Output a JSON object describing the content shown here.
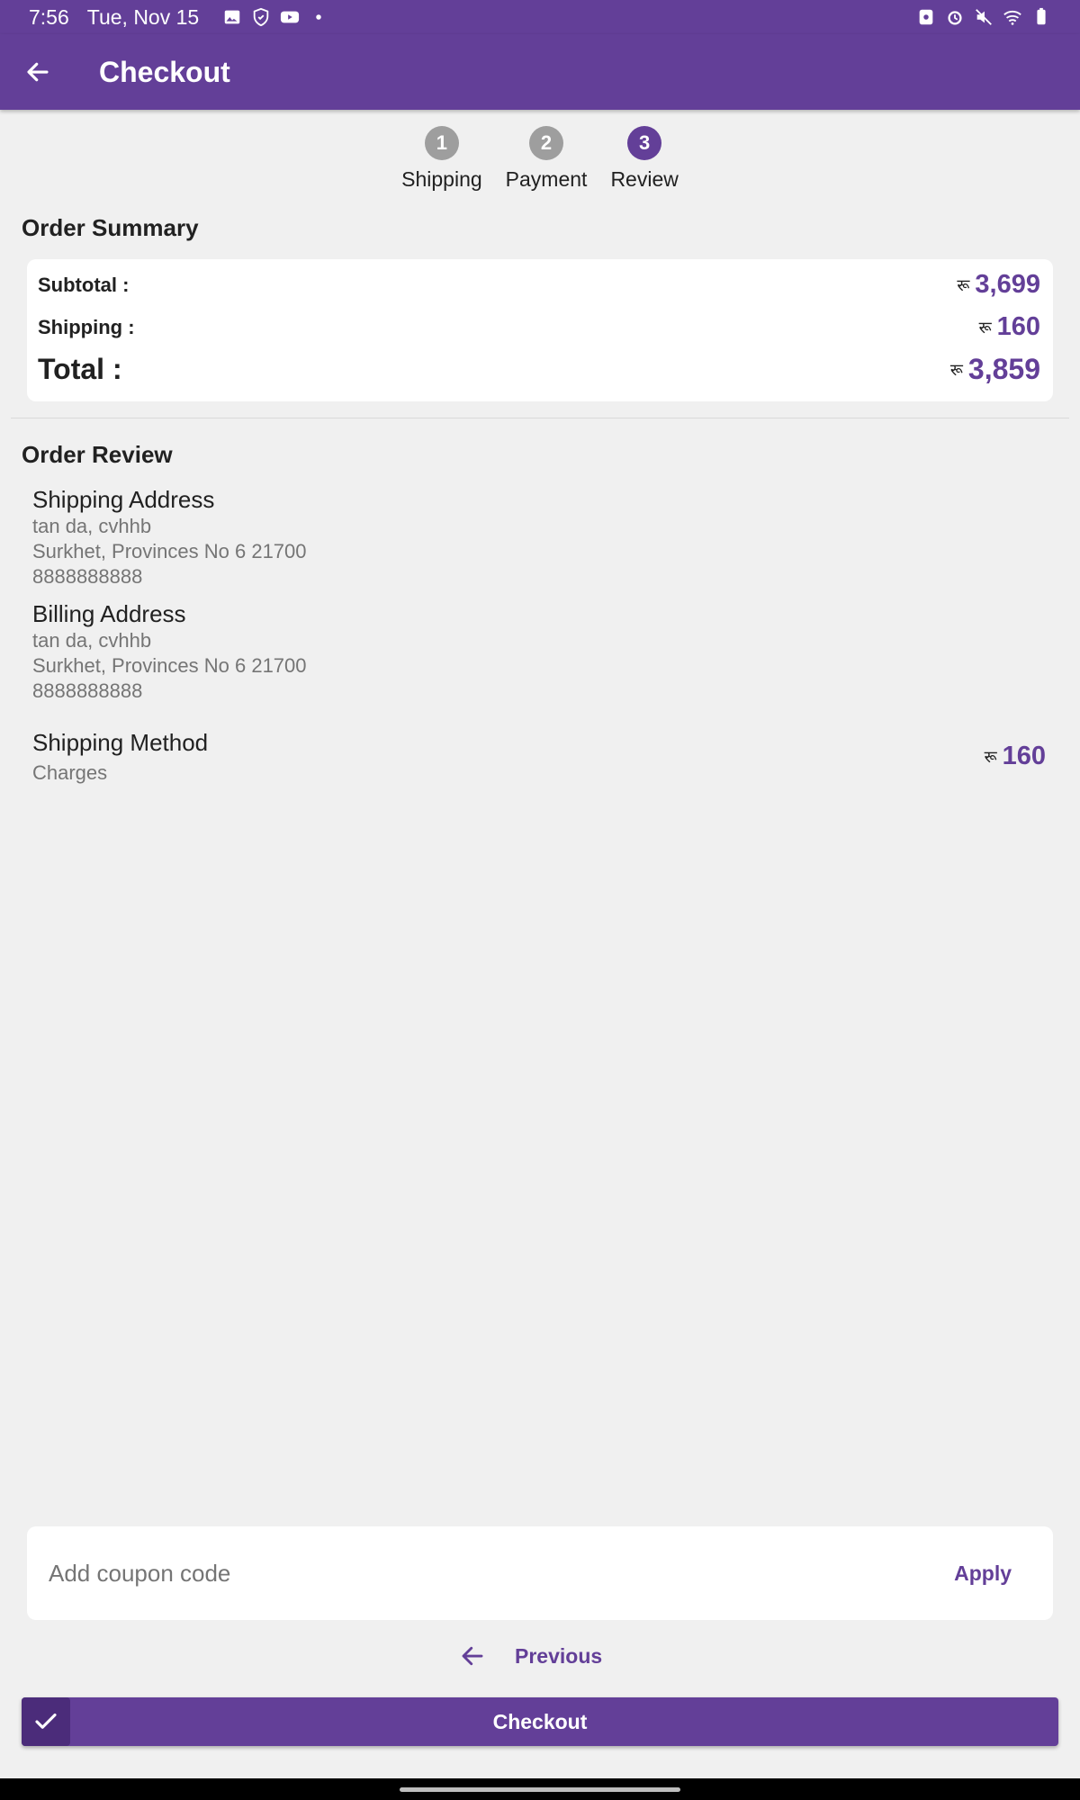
{
  "status_bar": {
    "time": "7:56",
    "date": "Tue, Nov 15",
    "left_icons": [
      "gallery-icon",
      "hand-shield-icon",
      "youtube-icon",
      "dot-icon"
    ],
    "right_icons": [
      "nfc-icon",
      "alarm-icon",
      "mute-icon",
      "wifi-icon",
      "battery-icon"
    ]
  },
  "app_bar": {
    "title": "Checkout"
  },
  "stepper": {
    "steps": [
      {
        "number": "1",
        "label": "Shipping",
        "state": "done"
      },
      {
        "number": "2",
        "label": "Payment",
        "state": "done"
      },
      {
        "number": "3",
        "label": "Review",
        "state": "active"
      }
    ]
  },
  "order_summary": {
    "heading": "Order Summary",
    "currency_symbol": "रू",
    "subtotal_label": "Subtotal :",
    "subtotal_value": "3,699",
    "shipping_label": "Shipping :",
    "shipping_value": "160",
    "total_label": "Total :",
    "total_value": "3,859"
  },
  "order_review": {
    "heading": "Order Review",
    "shipping_address": {
      "title": "Shipping Address",
      "name": "tan da, cvhhb",
      "location": "Surkhet, Provinces No 6 21700",
      "phone": "8888888888"
    },
    "billing_address": {
      "title": "Billing Address",
      "name": "tan da, cvhhb",
      "location": "Surkhet, Provinces No 6 21700",
      "phone": "8888888888"
    },
    "shipping_method": {
      "title": "Shipping Method",
      "subtitle": "Charges",
      "currency_symbol": "रू",
      "value": "160"
    }
  },
  "coupon": {
    "placeholder": "Add coupon code",
    "value": "",
    "apply_label": "Apply"
  },
  "previous_label": "Previous",
  "checkout_label": "Checkout",
  "colors": {
    "primary": "#633f98",
    "primary_dark": "#4b2c7a",
    "background": "#f0f0f0",
    "muted_text": "#757575"
  }
}
